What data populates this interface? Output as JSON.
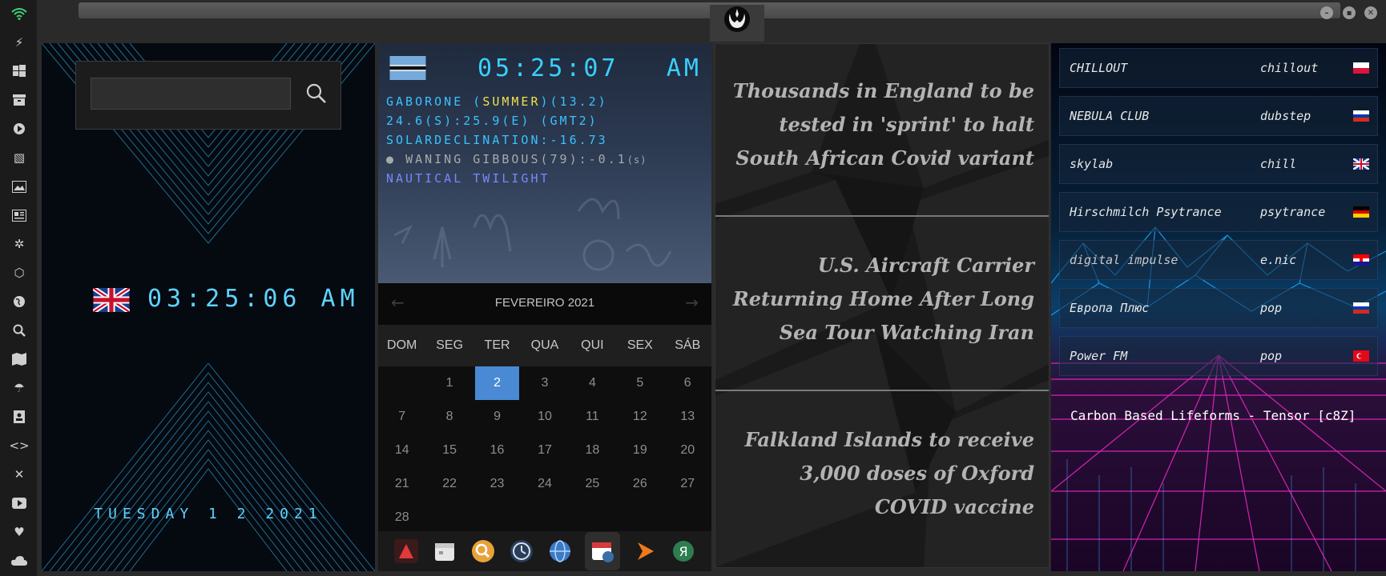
{
  "sidebar": {
    "icons": [
      "wifi-icon",
      "lightning-icon",
      "windows-icon",
      "archive-icon",
      "play-icon",
      "maps-icon",
      "image-icon",
      "news-icon",
      "settings-icon",
      "hexagon-icon",
      "globe-icon",
      "search-icon",
      "map-icon",
      "umbrella-icon",
      "contacts-icon",
      "code-icon",
      "expand-icon",
      "youtube-icon",
      "heart-icon",
      "cloud-icon"
    ]
  },
  "world_clock": {
    "search_placeholder": "",
    "local_time": "03:25:06 AM",
    "local_date": "TUESDAY 1 2 2021"
  },
  "gaborone": {
    "time": "05:25:07",
    "ampm": "AM",
    "city": "GABORONE",
    "summer": "SUMMER",
    "offset": "(13.2)",
    "coords": "24.6(S):25.9(E) (GMT2)",
    "declination": "SOLARDECLINATION:-16.73",
    "moon": "WANING GIBBOUS(79):-0.1",
    "moon_unit": "(s)",
    "twilight": "NAUTICAL TWILIGHT"
  },
  "calendar": {
    "month": "FEVEREIRO 2021",
    "prev": "←",
    "next": "→",
    "weekdays": [
      "DOM",
      "SEG",
      "TER",
      "QUA",
      "QUI",
      "SEX",
      "SÁB"
    ],
    "weeks": [
      [
        "",
        "1",
        "2",
        "3",
        "4",
        "5",
        "6"
      ],
      [
        "7",
        "8",
        "9",
        "10",
        "11",
        "12",
        "13"
      ],
      [
        "14",
        "15",
        "16",
        "17",
        "18",
        "19",
        "20"
      ],
      [
        "21",
        "22",
        "23",
        "24",
        "25",
        "26",
        "27"
      ],
      [
        "28",
        "",
        "",
        "",
        "",
        "",
        ""
      ]
    ],
    "selected": "2"
  },
  "dock": [
    "anydesk-icon",
    "calendar-icon",
    "search-icon",
    "clock-icon",
    "globe-icon",
    "calendar-clock-icon",
    "play-icon",
    "app-icon"
  ],
  "news": {
    "items": [
      "Thousands in England to be tested in 'sprint' to halt South African Covid variant",
      "U.S. Aircraft Carrier Returning Home After Long Sea Tour Watching Iran",
      "Falkland Islands to receive 3,000 doses of Oxford COVID vaccine"
    ]
  },
  "radio": {
    "stations": [
      {
        "name": "CHILLOUT",
        "genre": "chillout",
        "flag": "poland"
      },
      {
        "name": "NEBULA CLUB",
        "genre": "dubstep",
        "flag": "russia"
      },
      {
        "name": "skylab",
        "genre": "chill",
        "flag": "uk"
      },
      {
        "name": "Hirschmilch Psytrance",
        "genre": "psytrance",
        "flag": "germany"
      },
      {
        "name": "digital impulse",
        "genre": "e.nic",
        "flag": "croatia"
      },
      {
        "name": "Европа Плюс",
        "genre": "pop",
        "flag": "russia"
      },
      {
        "name": "Power FM",
        "genre": "pop",
        "flag": "turkey"
      }
    ],
    "now_playing": "Carbon Based Lifeforms - Tensor [c8Z]"
  }
}
